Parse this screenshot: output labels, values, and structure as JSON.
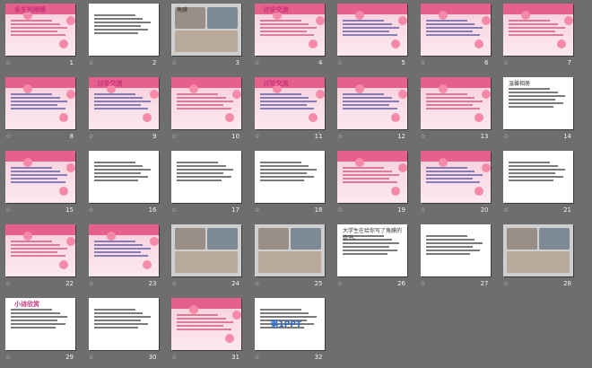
{
  "slides": [
    {
      "n": "1",
      "title": "永生的眼睛",
      "theme": "pink"
    },
    {
      "n": "2",
      "theme": "white"
    },
    {
      "n": "3",
      "theme": "photo",
      "label": "角膜"
    },
    {
      "n": "4",
      "title": "讨论交流",
      "theme": "pink"
    },
    {
      "n": "5",
      "theme": "pink"
    },
    {
      "n": "6",
      "theme": "pink"
    },
    {
      "n": "7",
      "theme": "pink"
    },
    {
      "n": "8",
      "theme": "pink"
    },
    {
      "n": "9",
      "title": "讨论交流",
      "theme": "pink"
    },
    {
      "n": "10",
      "theme": "pink"
    },
    {
      "n": "11",
      "title": "讨论交流",
      "theme": "pink"
    },
    {
      "n": "12",
      "theme": "pink"
    },
    {
      "n": "13",
      "theme": "pink"
    },
    {
      "n": "14",
      "theme": "white",
      "label": "温馨相册"
    },
    {
      "n": "15",
      "theme": "pink"
    },
    {
      "n": "16",
      "theme": "white"
    },
    {
      "n": "17",
      "theme": "white"
    },
    {
      "n": "18",
      "theme": "white"
    },
    {
      "n": "19",
      "theme": "pink"
    },
    {
      "n": "20",
      "theme": "pink"
    },
    {
      "n": "21",
      "theme": "white"
    },
    {
      "n": "22",
      "theme": "pink"
    },
    {
      "n": "23",
      "theme": "pink"
    },
    {
      "n": "24",
      "theme": "photo"
    },
    {
      "n": "25",
      "theme": "photo"
    },
    {
      "n": "26",
      "theme": "white",
      "label": "大学生在给你写了角膜的信书。"
    },
    {
      "n": "27",
      "theme": "white"
    },
    {
      "n": "28",
      "theme": "photo"
    },
    {
      "n": "29",
      "title": "小诗欣赏",
      "theme": "white"
    },
    {
      "n": "30",
      "theme": "white"
    },
    {
      "n": "31",
      "theme": "pink"
    },
    {
      "n": "32",
      "theme": "white",
      "label": "第1PPT"
    }
  ]
}
